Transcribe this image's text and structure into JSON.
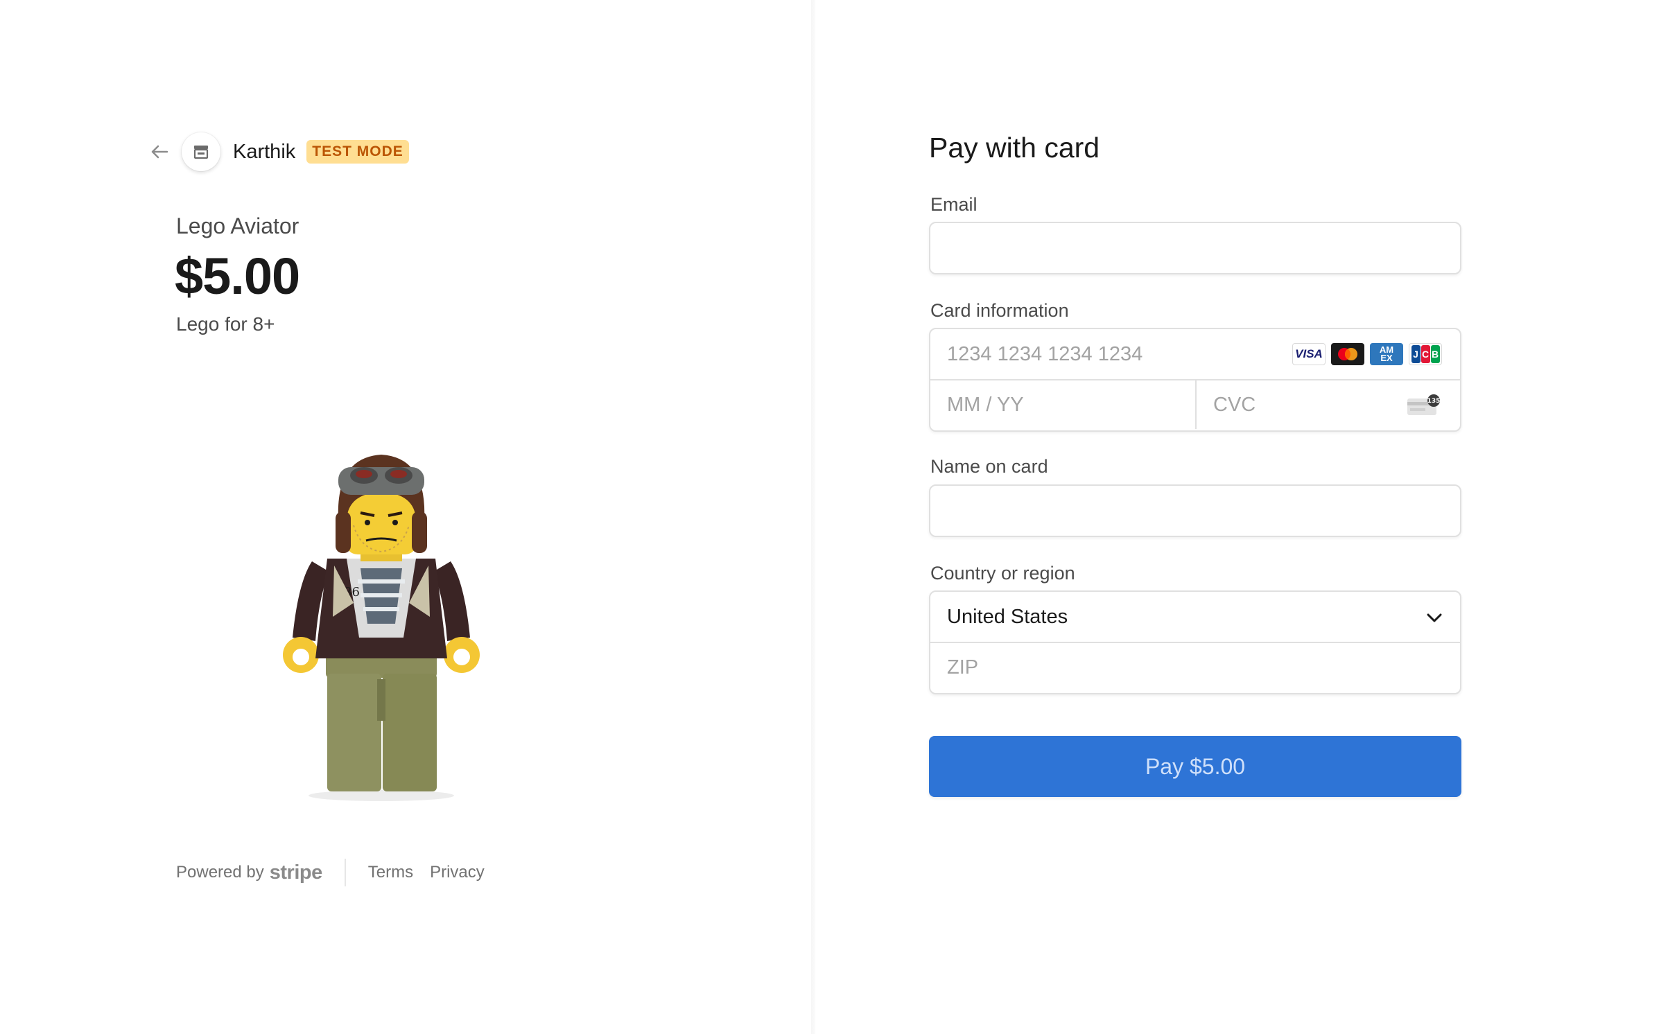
{
  "header": {
    "merchant_name": "Karthik",
    "badge": "TEST MODE",
    "back_icon": "arrow-left-icon",
    "store_icon": "store-icon"
  },
  "product": {
    "name": "Lego Aviator",
    "price": "$5.00",
    "description": "Lego for 8+",
    "image_text": "86"
  },
  "footer": {
    "powered_by": "Powered by",
    "brand": "stripe",
    "terms": "Terms",
    "privacy": "Privacy"
  },
  "form": {
    "title": "Pay with card",
    "email": {
      "label": "Email",
      "value": ""
    },
    "card": {
      "label": "Card information",
      "number_placeholder": "1234 1234 1234 1234",
      "expiry_placeholder": "MM / YY",
      "cvc_placeholder": "CVC",
      "brands": [
        "VISA",
        "mastercard",
        "AMEX",
        "JCB"
      ],
      "amex_line1": "AM",
      "amex_line2": "EX",
      "jcb_letters": [
        "J",
        "C",
        "B"
      ],
      "cvc_badge": "135"
    },
    "name": {
      "label": "Name on card",
      "value": ""
    },
    "country": {
      "label": "Country or region",
      "selected": "United States",
      "zip_placeholder": "ZIP"
    },
    "pay_button": "Pay $5.00"
  },
  "colors": {
    "pay_button": "#2e74d6",
    "badge_bg": "#ffde92",
    "badge_text": "#bb5504"
  }
}
